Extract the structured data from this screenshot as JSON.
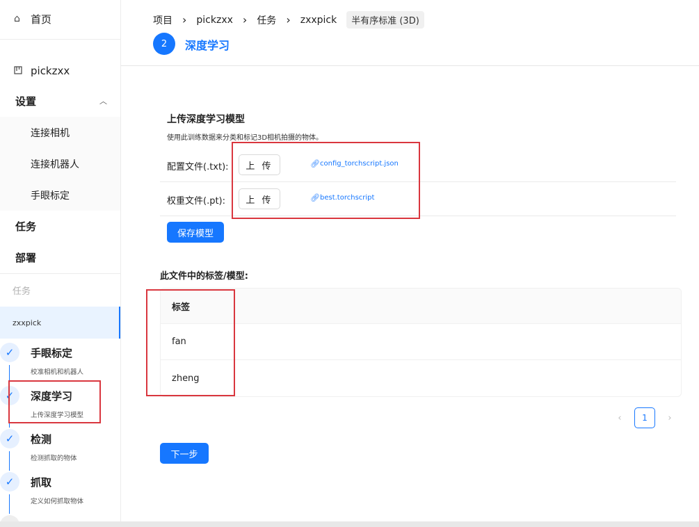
{
  "sidebar": {
    "home": "首页",
    "project": "pickzxx",
    "settings": "设置",
    "settings_items": [
      "连接相机",
      "连接机器人",
      "手眼标定"
    ],
    "tasks": "任务",
    "deploy": "部署",
    "group_title": "任务",
    "selected_task": "zxxpick",
    "steps": [
      {
        "title": "手眼标定",
        "desc": "校准相机和机器人"
      },
      {
        "title": "深度学习",
        "desc": "上传深度学习模型"
      },
      {
        "title": "检测",
        "desc": "检测抓取的物体"
      },
      {
        "title": "抓取",
        "desc": "定义如何抓取物体"
      }
    ],
    "step_check": "✓"
  },
  "header": {
    "breadcrumb": [
      "项目",
      "pickzxx",
      "任务",
      "zxxpick"
    ],
    "breadcrumb_last": "半有序标准 (3D)",
    "step_number": "2",
    "step_name": "深度学习"
  },
  "upload": {
    "title": "上传深度学习模型",
    "desc": "使用此训练数据来分类和标记3D相机拍摄的物体。",
    "config_label": "配置文件(.txt):",
    "weights_label": "权重文件(.pt):",
    "upload_label": "上 传",
    "config_file": "config_torchscript.json",
    "weights_file": "best.torchscript",
    "save_label": "保存模型"
  },
  "labels_table": {
    "title": "此文件中的标签/模型:",
    "header": "标签",
    "rows": [
      "fan",
      "zheng"
    ]
  },
  "pagination": {
    "current": "1",
    "prev": "‹",
    "next": "›"
  },
  "next_label": "下一步",
  "colors": {
    "primary": "#1677ff",
    "annotation_red": "#d9363e"
  }
}
